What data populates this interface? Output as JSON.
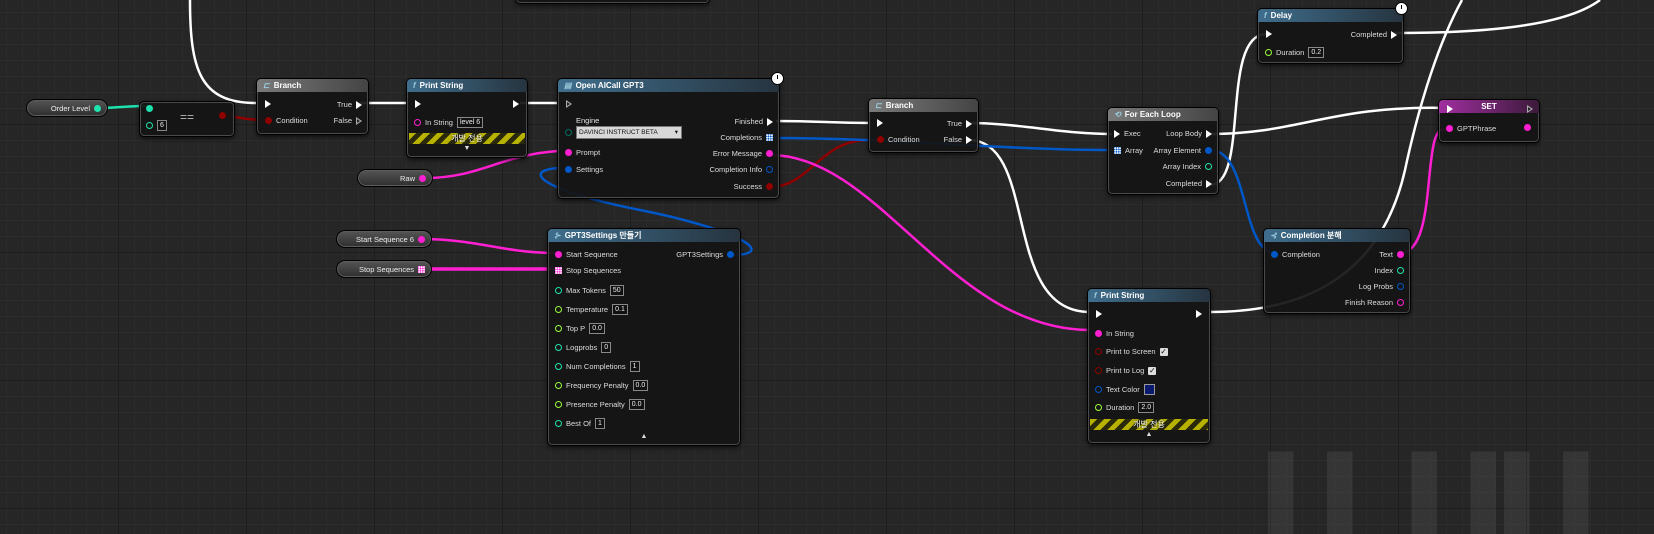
{
  "colors": {
    "exec": "#ffffff",
    "string": "#ff1fd2",
    "bool": "#8f0000",
    "struct": "#0057c8",
    "int": "#1fe3af",
    "float": "#9cfc3a",
    "text": "#e07ee0",
    "enum": "#006e62"
  },
  "vars": {
    "order_level": "Order Level",
    "raw": "Raw",
    "start_sequence": "Start Sequence 6",
    "stop_sequences": "Stop Sequences"
  },
  "equal": {
    "title": "==",
    "value": "6"
  },
  "branch1": {
    "title": "Branch",
    "true": "True",
    "false": "False",
    "condition": "Condition"
  },
  "print1": {
    "title": "Print String",
    "in_string": "In String",
    "value": "level 6",
    "dev_only": "개발 전용"
  },
  "openai": {
    "title": "Open AICall GPT3",
    "engine": "Engine",
    "engine_value": "DAVINCI INSTRUCT BETA",
    "prompt": "Prompt",
    "settings": "Settings",
    "finished": "Finished",
    "completions": "Completions",
    "error_message": "Error Message",
    "completion_info": "Completion Info",
    "success": "Success"
  },
  "branch2": {
    "title": "Branch",
    "true": "True",
    "false": "False",
    "condition": "Condition"
  },
  "foreach": {
    "title": "For Each Loop",
    "exec": "Exec",
    "array": "Array",
    "loop_body": "Loop Body",
    "array_element": "Array Element",
    "array_index": "Array Index",
    "completed": "Completed"
  },
  "delay": {
    "title": "Delay",
    "completed": "Completed",
    "duration": "Duration",
    "duration_value": "0.2"
  },
  "set": {
    "title": "SET",
    "var": "GPTPhrase"
  },
  "settings_node": {
    "title": "GPT3Settings 만들기",
    "out": "GPT3Settings",
    "start_sequence": "Start Sequence",
    "stop_sequences": "Stop Sequences",
    "rows": [
      {
        "label": "Max Tokens",
        "value": "50",
        "type": "int"
      },
      {
        "label": "Temperature",
        "value": "0.1",
        "type": "float"
      },
      {
        "label": "Top P",
        "value": "0.0",
        "type": "float"
      },
      {
        "label": "Logprobs",
        "value": "0",
        "type": "int"
      },
      {
        "label": "Num Completions",
        "value": "1",
        "type": "int"
      },
      {
        "label": "Frequency Penalty",
        "value": "0.0",
        "type": "float"
      },
      {
        "label": "Presence Penalty",
        "value": "0.0",
        "type": "float"
      },
      {
        "label": "Best Of",
        "value": "1",
        "type": "int"
      }
    ]
  },
  "completion_break": {
    "title": "Completion 분해",
    "completion": "Completion",
    "text": "Text",
    "index": "Index",
    "log_probs": "Log Probs",
    "finish_reason": "Finish Reason"
  },
  "print2": {
    "title": "Print String",
    "in_string": "In String",
    "print_to_screen": "Print to Screen",
    "print_to_log": "Print to Log",
    "text_color": "Text Color",
    "duration": "Duration",
    "duration_value": "2.0",
    "dev_only": "개발 전용"
  }
}
